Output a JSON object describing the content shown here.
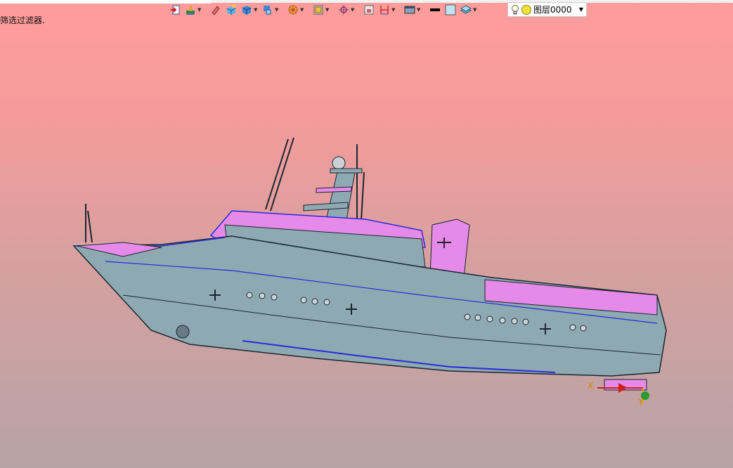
{
  "status": {
    "message": "筛选过滤器."
  },
  "toolbar": {
    "buttons": [
      {
        "name": "exit-sketch-icon",
        "dropdown": false
      },
      {
        "name": "paint-brush-icon",
        "dropdown": true
      },
      {
        "name": "eraser-icon",
        "dropdown": false
      },
      {
        "name": "box-shaded-icon",
        "dropdown": false
      },
      {
        "name": "cube-view-icon",
        "dropdown": true
      },
      {
        "name": "render-style-icon",
        "dropdown": true
      },
      {
        "name": "section-view-icon",
        "dropdown": true
      },
      {
        "name": "display-filter-icon",
        "dropdown": true
      },
      {
        "name": "snap-point-icon",
        "dropdown": true
      },
      {
        "name": "frame-view-icon",
        "dropdown": false
      },
      {
        "name": "dimension-icon",
        "dropdown": true
      },
      {
        "name": "background-icon",
        "dropdown": true
      },
      {
        "name": "line-color-icon",
        "dropdown": false
      },
      {
        "name": "fill-color-icon",
        "dropdown": false
      },
      {
        "name": "layers-icon",
        "dropdown": true
      }
    ]
  },
  "layer": {
    "name": "图层0000"
  },
  "axes": {
    "x_label": "X",
    "y_label": "Y"
  },
  "colors": {
    "hull": "#8fa9b2",
    "highlight": "#e58ae8",
    "edge": "#2a2ad8",
    "line": "#1a2630",
    "bg_top": "#ff9c9c",
    "bg_bottom": "#b7a3a5"
  }
}
